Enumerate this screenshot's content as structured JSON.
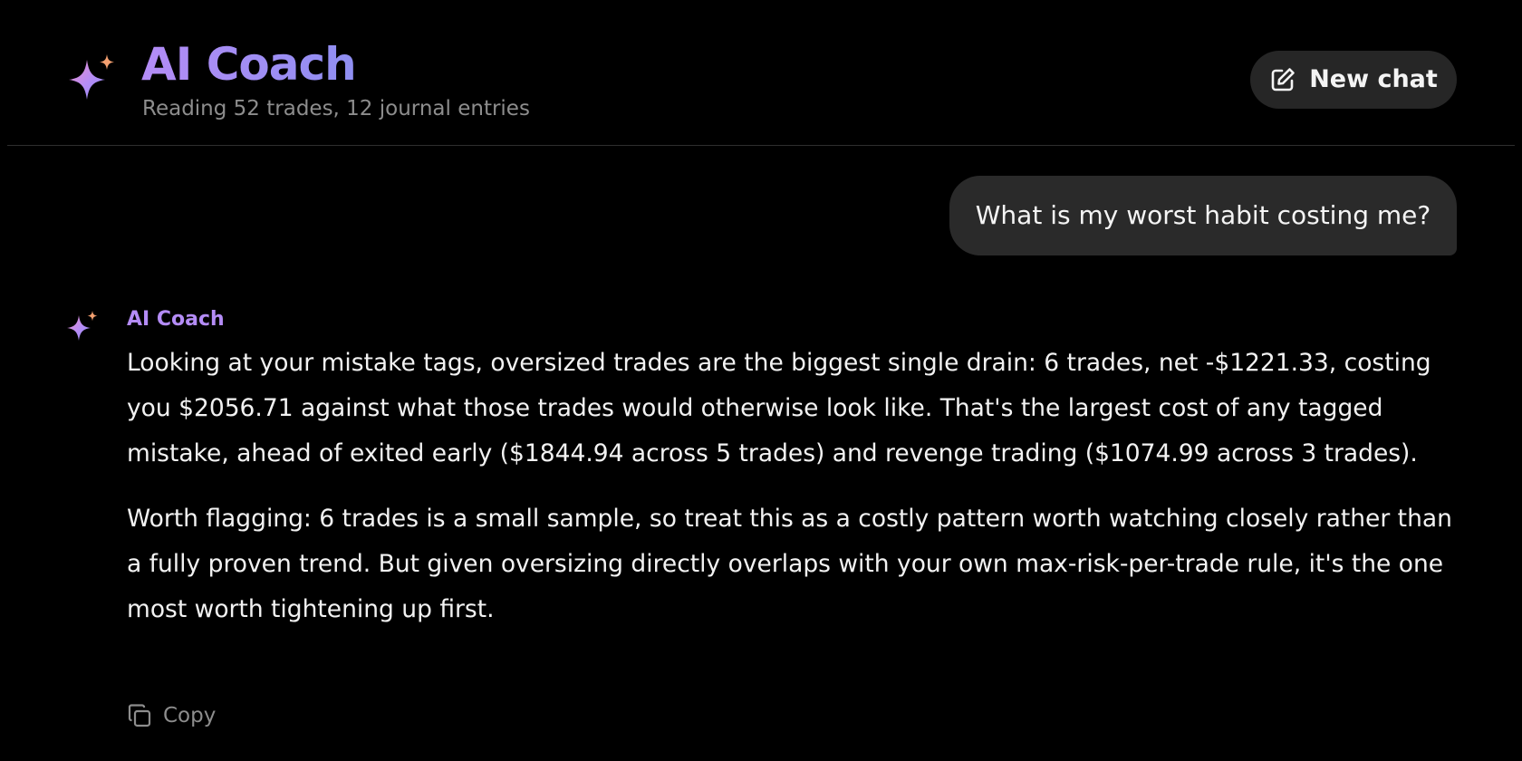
{
  "header": {
    "title": "AI Coach",
    "subtitle": "Reading 52 trades, 12 journal entries",
    "logo_icon": "sparkles-icon",
    "new_chat_label": "New chat",
    "new_chat_icon": "edit-icon"
  },
  "conversation": {
    "user_message": "What is my worst habit costing me?",
    "assistant": {
      "name": "AI Coach",
      "paragraphs": [
        "Looking at your mistake tags, oversized trades are the biggest single drain: 6 trades, net -$1221.33, costing you $2056.71 against what those trades would otherwise look like. That's the largest cost of any tagged mistake, ahead of exited early ($1844.94 across 5 trades) and revenge trading ($1074.99 across 3 trades).",
        "Worth flagging: 6 trades is a small sample, so treat this as a costly pattern worth watching closely rather than a fully proven trend. But given oversizing directly overlaps with your own max-risk-per-trade rule, it's the one most worth tightening up first."
      ],
      "copy_label": "Copy",
      "copy_icon": "copy-icon"
    }
  },
  "colors": {
    "background": "#000000",
    "accent_purple": "#b48cf6",
    "accent_pink": "#f08fc8",
    "accent_orange": "#f4a070",
    "bubble": "#2a2a2a",
    "button": "#262626",
    "muted_text": "#8d8d8d"
  }
}
